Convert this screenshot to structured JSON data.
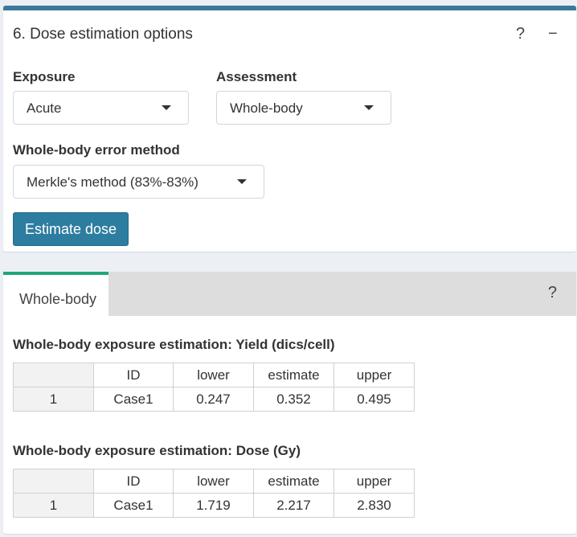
{
  "panel": {
    "title": "6. Dose estimation options",
    "help_label": "?",
    "collapse_label": "−"
  },
  "exposure": {
    "label": "Exposure",
    "value": "Acute"
  },
  "assessment": {
    "label": "Assessment",
    "value": "Whole-body"
  },
  "error_method": {
    "label": "Whole-body error method",
    "value": "Merkle's method (83%-83%)"
  },
  "estimate_button": "Estimate dose",
  "results": {
    "tab_label": "Whole-body",
    "help_label": "?",
    "yield_table": {
      "title": "Whole-body exposure estimation: Yield (dics/cell)",
      "headers": [
        "",
        "ID",
        "lower",
        "estimate",
        "upper"
      ],
      "rows": [
        [
          "1",
          "Case1",
          "0.247",
          "0.352",
          "0.495"
        ]
      ]
    },
    "dose_table": {
      "title": "Whole-body exposure estimation: Dose (Gy)",
      "headers": [
        "",
        "ID",
        "lower",
        "estimate",
        "upper"
      ],
      "rows": [
        [
          "1",
          "Case1",
          "1.719",
          "2.217",
          "2.830"
        ]
      ]
    }
  }
}
